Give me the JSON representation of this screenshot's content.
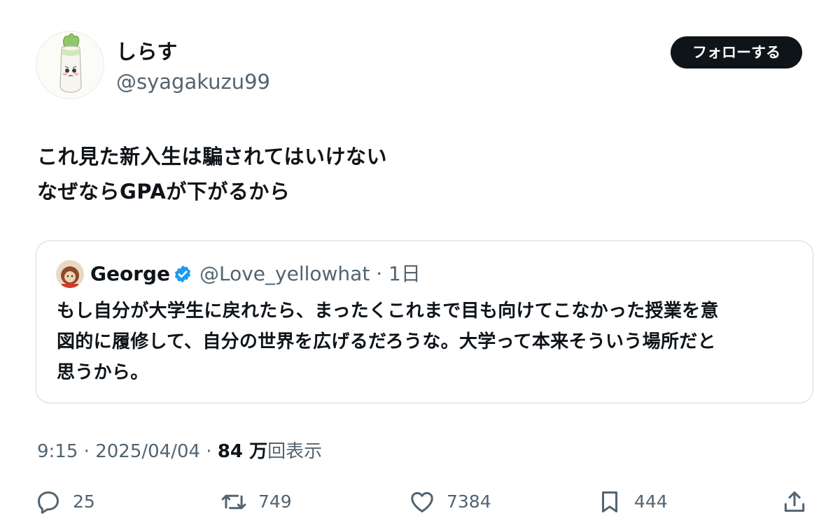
{
  "author": {
    "display_name": "しらす",
    "handle": "@syagakuzu99",
    "avatar_icon": "daikon-avatar-icon"
  },
  "follow_button": {
    "label": "フォローする"
  },
  "tweet": {
    "lines": [
      "これ見た新入生は騙されてはいけない",
      "なぜならGPAが下がるから"
    ]
  },
  "quoted": {
    "name": "George",
    "verified_icon": "verified-badge-icon",
    "handle": "@Love_yellowhat",
    "separator": " · ",
    "age": "1日",
    "lines": [
      "もし自分が大学生に戻れたら、まったくこれまで目も向けてこなかった授業を意",
      "図的に履修して、自分の世界を広げるだろうな。大学って本来そういう場所だと",
      "思うから。"
    ]
  },
  "meta": {
    "time": "9:15",
    "sep1": " · ",
    "date": "2025/04/04",
    "sep2": " · ",
    "views_number": "84 万",
    "views_label": "回表示"
  },
  "actions": {
    "replies": "25",
    "reposts": "749",
    "likes": "7384",
    "bookmarks": "444"
  },
  "colors": {
    "text": "#0f1419",
    "secondary": "#536471",
    "border": "#cfd9de",
    "verified": "#1d9bf0",
    "button_bg": "#0f1419"
  }
}
